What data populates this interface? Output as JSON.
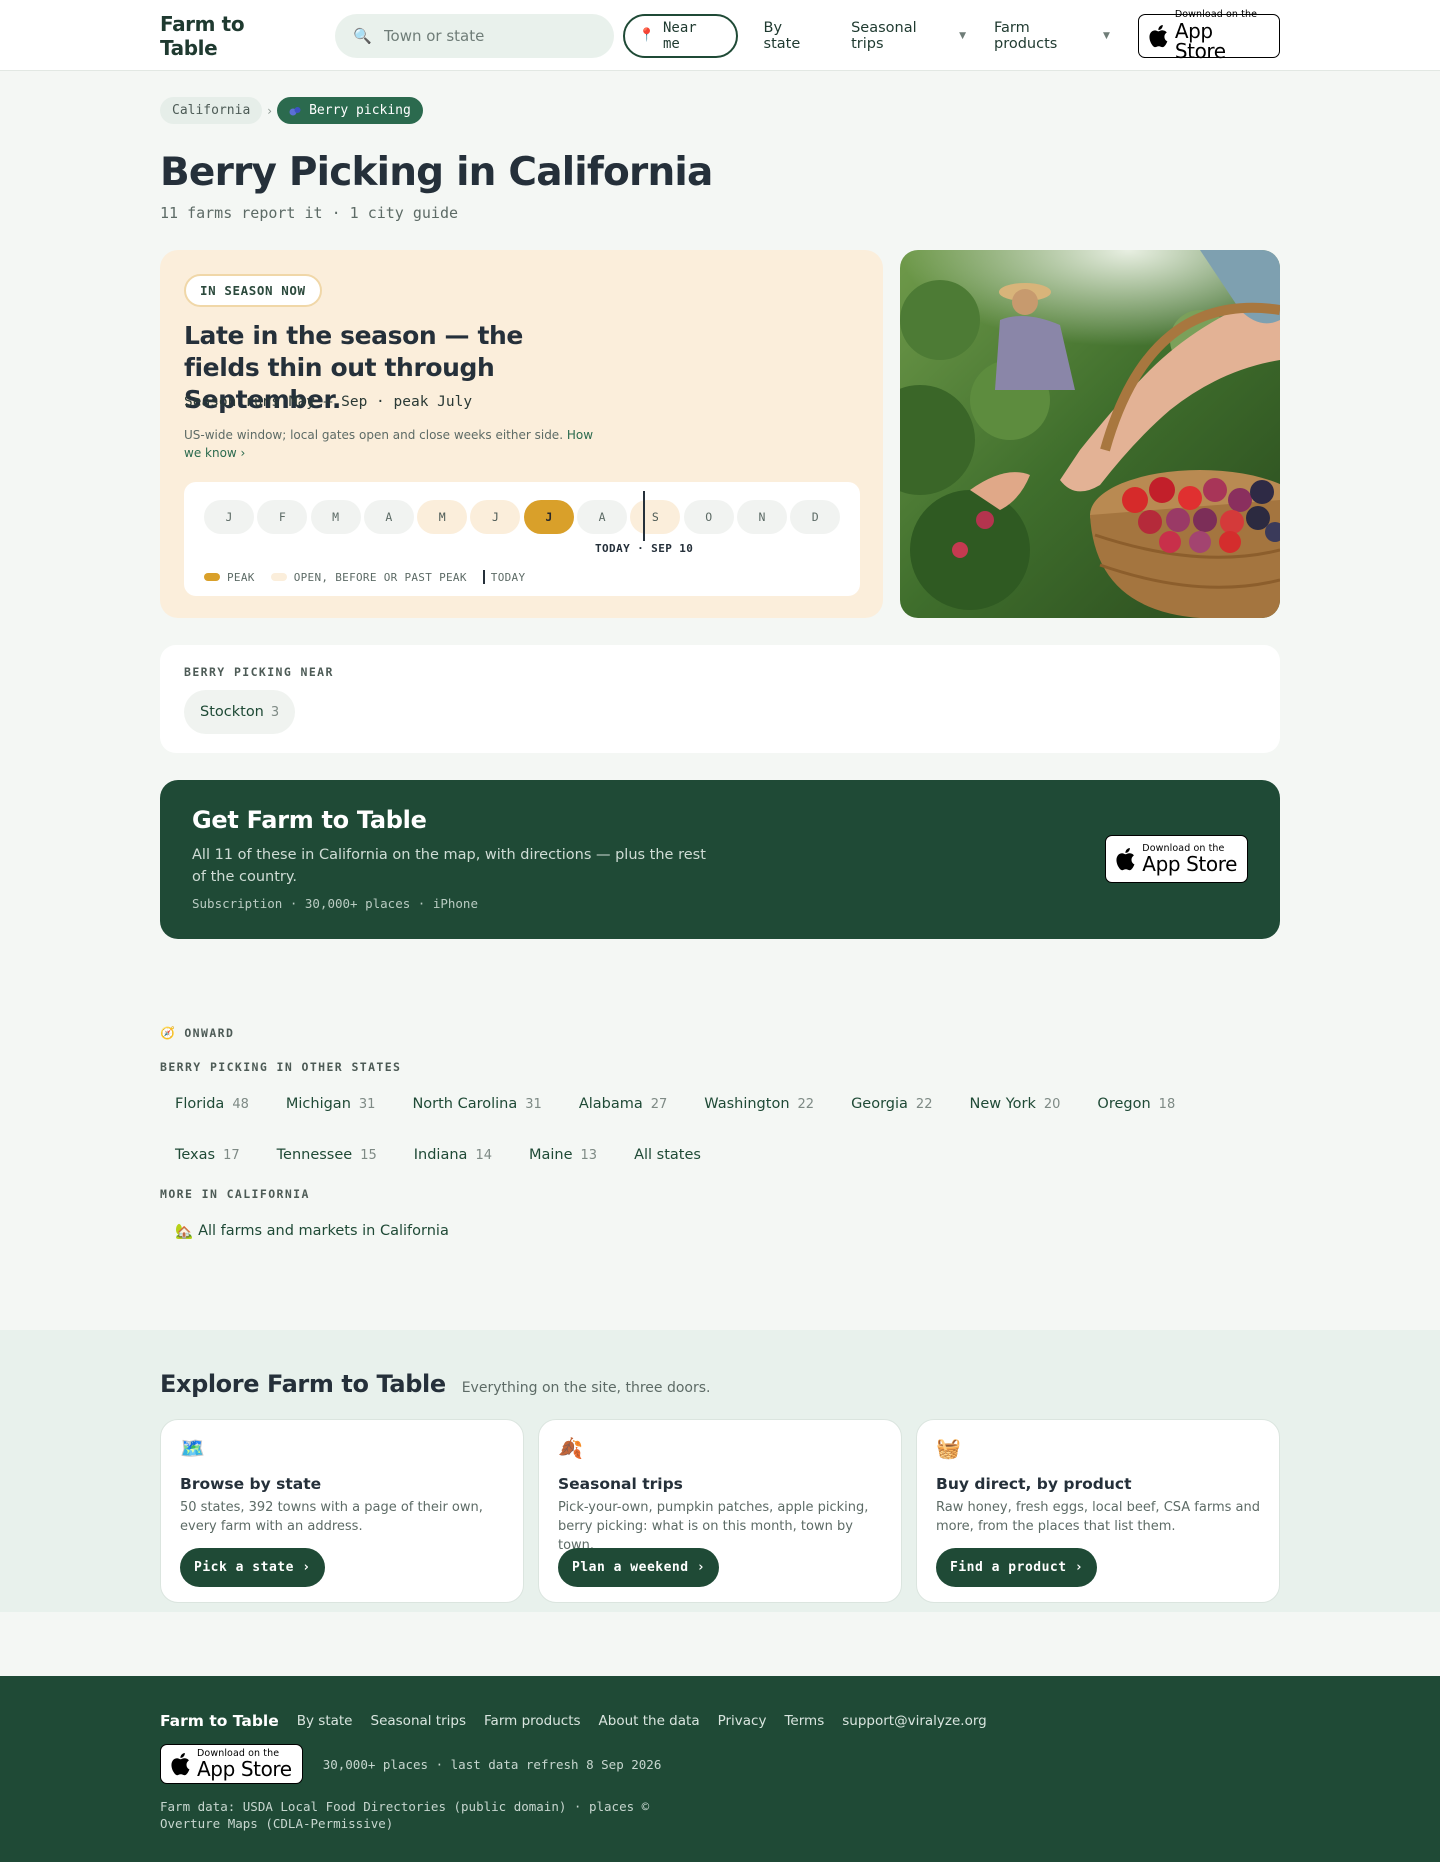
{
  "header": {
    "logo": "Farm to Table",
    "search_placeholder": "Town or state",
    "near_me": "Near me",
    "nav": [
      {
        "label": "By state",
        "has_menu": false
      },
      {
        "label": "Seasonal trips",
        "has_menu": true
      },
      {
        "label": "Farm products",
        "has_menu": true
      }
    ],
    "app_badge": {
      "small": "Download on the",
      "big": "App Store"
    }
  },
  "breadcrumb": {
    "state": "California",
    "activity": "Berry picking"
  },
  "page": {
    "title": "Berry Picking in California",
    "subtitle": "11 farms report it · 1 city guide"
  },
  "season": {
    "badge": "IN SEASON NOW",
    "headline": "Late in the season — the fields thin out through September.",
    "runs": "Season runs May – Sep · peak July",
    "note": "US-wide window; local gates open and close weeks either side.",
    "note_link": "How we know ›",
    "months": [
      {
        "label": "J",
        "state": "off"
      },
      {
        "label": "F",
        "state": "off"
      },
      {
        "label": "M",
        "state": "off"
      },
      {
        "label": "A",
        "state": "off"
      },
      {
        "label": "M",
        "state": "open"
      },
      {
        "label": "J",
        "state": "open"
      },
      {
        "label": "J",
        "state": "peak"
      },
      {
        "label": "A",
        "state": "off"
      },
      {
        "label": "S",
        "state": "open"
      },
      {
        "label": "O",
        "state": "off"
      },
      {
        "label": "N",
        "state": "off"
      },
      {
        "label": "D",
        "state": "off"
      }
    ],
    "today_label": "TODAY · SEP 10",
    "legend": {
      "peak": "PEAK",
      "open": "OPEN, BEFORE OR PAST PEAK",
      "today": "TODAY"
    },
    "colors": {
      "peak": "#d9a02a",
      "open": "#fbeedb",
      "card_bg": "#fbeedb"
    }
  },
  "near": {
    "heading": "BERRY PICKING NEAR",
    "places": [
      {
        "name": "Stockton",
        "count": "3"
      }
    ]
  },
  "promo": {
    "title": "Get Farm to Table",
    "body": "All 11 of these in California on the map, with directions — plus the rest of the country.",
    "meta": "Subscription · 30,000+ places · iPhone",
    "badge": {
      "small": "Download on the",
      "big": "App Store"
    }
  },
  "onward": {
    "eyebrow": "ONWARD",
    "other_states_heading": "BERRY PICKING IN OTHER STATES",
    "other_states": [
      {
        "name": "Florida",
        "count": "48"
      },
      {
        "name": "Michigan",
        "count": "31"
      },
      {
        "name": "North Carolina",
        "count": "31"
      },
      {
        "name": "Alabama",
        "count": "27"
      },
      {
        "name": "Washington",
        "count": "22"
      },
      {
        "name": "Georgia",
        "count": "22"
      },
      {
        "name": "New York",
        "count": "20"
      },
      {
        "name": "Oregon",
        "count": "18"
      },
      {
        "name": "Texas",
        "count": "17"
      },
      {
        "name": "Tennessee",
        "count": "15"
      },
      {
        "name": "Indiana",
        "count": "14"
      },
      {
        "name": "Maine",
        "count": "13"
      },
      {
        "name": "All states",
        "count": ""
      }
    ],
    "more_heading": "MORE IN CALIFORNIA",
    "more_link": "All farms and markets in California"
  },
  "explore": {
    "title": "Explore Farm to Table",
    "tagline": "Everything on the site, three doors.",
    "doors": [
      {
        "icon": "map-icon",
        "title": "Browse by state",
        "body": "50 states, 392 towns with a page of their own, every farm with an address.",
        "cta": "Pick a state ›"
      },
      {
        "icon": "leaf-icon",
        "title": "Seasonal trips",
        "body": "Pick-your-own, pumpkin patches, apple picking, berry picking: what is on this month, town by town.",
        "cta": "Plan a weekend ›"
      },
      {
        "icon": "basket-icon",
        "title": "Buy direct, by product",
        "body": "Raw honey, fresh eggs, local beef, CSA farms and more, from the places that list them.",
        "cta": "Find a product ›"
      }
    ]
  },
  "footer": {
    "logo": "Farm to Table",
    "links": [
      "By state",
      "Seasonal trips",
      "Farm products",
      "About the data",
      "Privacy",
      "Terms",
      "support@viralyze.org"
    ],
    "badge": {
      "small": "Download on the",
      "big": "App Store"
    },
    "meta": "30,000+ places · last data refresh 8 Sep 2026",
    "credits": "Farm data: USDA Local Food Directories (public domain) · places © Overture Maps (CDLA-Permissive)"
  }
}
